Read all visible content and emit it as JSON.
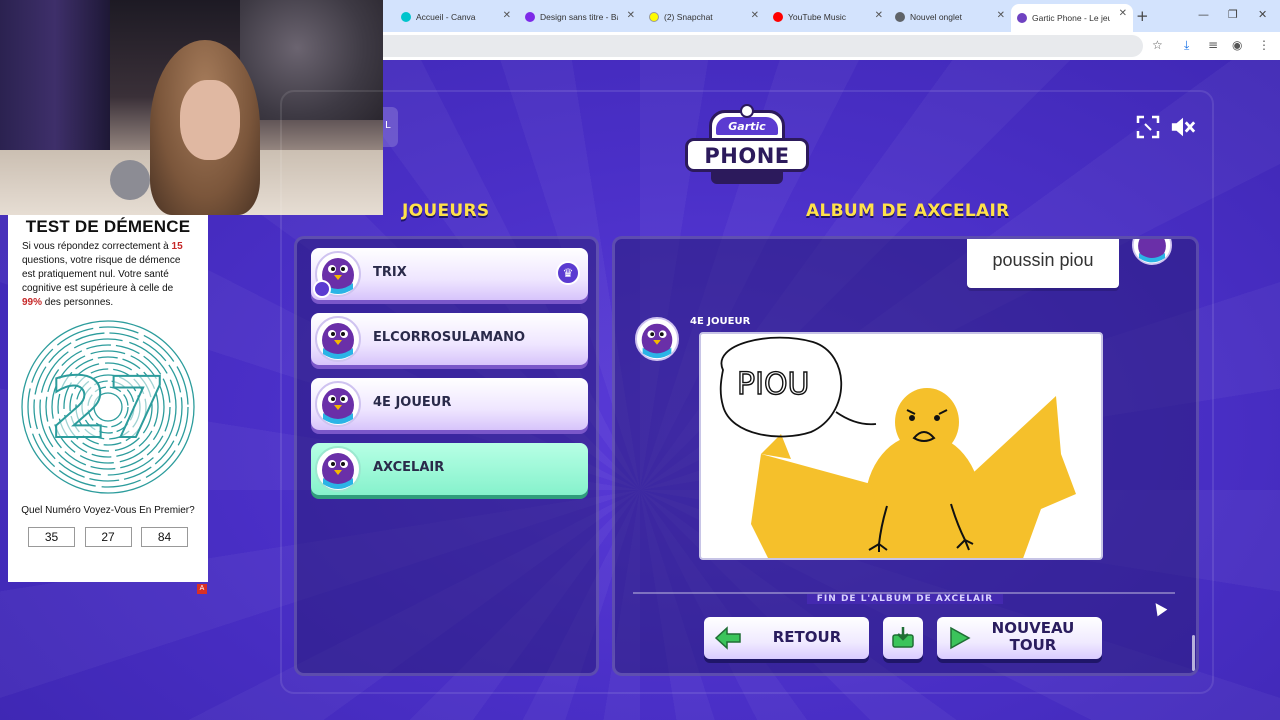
{
  "browser": {
    "tabs": [
      {
        "title": "Accueil - Canva",
        "favicon_color": "#00c4cc"
      },
      {
        "title": "Design sans titre - Ba",
        "favicon_color": "#7d2ae8"
      },
      {
        "title": "(2) Snapchat",
        "favicon_color": "#fffc00"
      },
      {
        "title": "YouTube Music",
        "favicon_color": "#ff0000"
      },
      {
        "title": "Nouvel onglet",
        "favicon_color": "#5f6368"
      },
      {
        "title": "Gartic Phone - Le jeu",
        "favicon_color": "#6f42c1",
        "active": true
      }
    ],
    "new_tab_symbol": "+"
  },
  "ad": {
    "title": "TEST DE DÉMENCE",
    "desc_1": "Si vous répondez correctement à ",
    "desc_num": "15",
    "desc_2": " questions, votre risque de démence est pratiquement nul. Votre santé cognitive est supérieure à celle de ",
    "desc_pct": "99%",
    "desc_3": " des personnes.",
    "maze_number": "27",
    "question": "Quel Numéro Voyez-Vous En Premier?",
    "options": [
      "35",
      "27",
      "84"
    ],
    "adchoice_label": "A"
  },
  "game": {
    "leftstub_label": "L",
    "logo_top": "Gartic",
    "logo_main": "PHONE",
    "players_title": "JOUEURS",
    "album_title": "ALBUM DE AXCELAIR",
    "players": [
      {
        "name": "TRIX",
        "host": true,
        "crown": true
      },
      {
        "name": "ELCORROSULAMANO"
      },
      {
        "name": "4E JOUEUR"
      },
      {
        "name": "AXCELAIR",
        "active": true
      }
    ],
    "album": {
      "previous_text": "poussin piou",
      "entry_author": "4E JOUEUR",
      "drawing_text": "PIOU",
      "end_label": "FIN DE L'ALBUM DE AXCELAIR"
    },
    "buttons": {
      "back": "RETOUR",
      "new_round_1": "NOUVEAU",
      "new_round_2": "TOUR"
    },
    "colors": {
      "title_yellow": "#ffe14a",
      "active_player": "#86f2cc",
      "bird_yellow": "#f5c02b"
    }
  }
}
